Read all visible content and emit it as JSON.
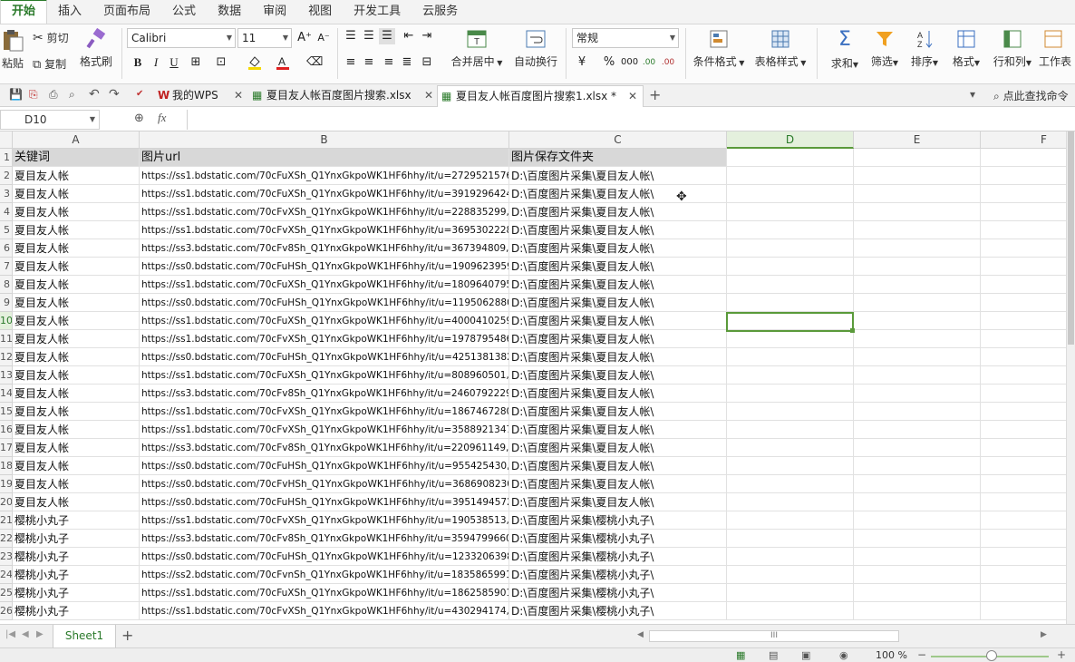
{
  "menu": [
    "开始",
    "插入",
    "页面布局",
    "公式",
    "数据",
    "审阅",
    "视图",
    "开发工具",
    "云服务"
  ],
  "ribbon": {
    "paste": "粘贴",
    "cut": "剪切",
    "copy": "复制",
    "format_painter": "格式刷",
    "font_name": "Calibri",
    "font_size": "11",
    "merge_center": "合并居中",
    "wrap_text": "自动换行",
    "number_format": "常规",
    "conditional_format": "条件格式",
    "table_style": "表格样式",
    "sum": "求和",
    "filter": "筛选",
    "sort": "排序",
    "format": "格式",
    "row_col": "行和列",
    "worksheet": "工作表",
    "percent": "%",
    "thousands": "000",
    "inc_decimal": ".00",
    "dec_decimal": ".00",
    "font_color": "#e02020",
    "fill_color": "#f5d800"
  },
  "tabs": [
    {
      "label": "我的WPS"
    },
    {
      "label": "夏目友人帐百度图片搜索.xlsx"
    },
    {
      "label": "夏目友人帐百度图片搜索1.xlsx *"
    }
  ],
  "find_command": "点此查找命令",
  "name_box": "D10",
  "fx": "fx",
  "columns": [
    "A",
    "B",
    "C",
    "D",
    "E",
    "F"
  ],
  "header_row": {
    "row": "1",
    "a": "关键词",
    "b": "图片url",
    "c": "图片保存文件夹"
  },
  "rows": [
    {
      "row": "2",
      "a": "夏目友人帐",
      "b": "https://ss1.bdstatic.com/70cFuXSh_Q1YnxGkpoWK1HF6hhy/it/u=2729521576",
      "c": "D:\\百度图片采集\\夏目友人帐\\"
    },
    {
      "row": "3",
      "a": "夏目友人帐",
      "b": "https://ss1.bdstatic.com/70cFuXSh_Q1YnxGkpoWK1HF6hhy/it/u=3919296424",
      "c": "D:\\百度图片采集\\夏目友人帐\\"
    },
    {
      "row": "4",
      "a": "夏目友人帐",
      "b": "https://ss1.bdstatic.com/70cFvXSh_Q1YnxGkpoWK1HF6hhy/it/u=228835299,3",
      "c": "D:\\百度图片采集\\夏目友人帐\\"
    },
    {
      "row": "5",
      "a": "夏目友人帐",
      "b": "https://ss1.bdstatic.com/70cFvXSh_Q1YnxGkpoWK1HF6hhy/it/u=3695302228,",
      "c": "D:\\百度图片采集\\夏目友人帐\\"
    },
    {
      "row": "6",
      "a": "夏目友人帐",
      "b": "https://ss3.bdstatic.com/70cFv8Sh_Q1YnxGkpoWK1HF6hhy/it/u=367394809,4",
      "c": "D:\\百度图片采集\\夏目友人帐\\"
    },
    {
      "row": "7",
      "a": "夏目友人帐",
      "b": "https://ss0.bdstatic.com/70cFuHSh_Q1YnxGkpoWK1HF6hhy/it/u=1909623959",
      "c": "D:\\百度图片采集\\夏目友人帐\\"
    },
    {
      "row": "8",
      "a": "夏目友人帐",
      "b": "https://ss1.bdstatic.com/70cFuXSh_Q1YnxGkpoWK1HF6hhy/it/u=1809640795",
      "c": "D:\\百度图片采集\\夏目友人帐\\"
    },
    {
      "row": "9",
      "a": "夏目友人帐",
      "b": "https://ss0.bdstatic.com/70cFuHSh_Q1YnxGkpoWK1HF6hhy/it/u=1195062880",
      "c": "D:\\百度图片采集\\夏目友人帐\\"
    },
    {
      "row": "10",
      "a": "夏目友人帐",
      "b": "https://ss1.bdstatic.com/70cFuXSh_Q1YnxGkpoWK1HF6hhy/it/u=4000410259",
      "c": "D:\\百度图片采集\\夏目友人帐\\"
    },
    {
      "row": "11",
      "a": "夏目友人帐",
      "b": "https://ss1.bdstatic.com/70cFvXSh_Q1YnxGkpoWK1HF6hhy/it/u=1978795486,",
      "c": "D:\\百度图片采集\\夏目友人帐\\"
    },
    {
      "row": "12",
      "a": "夏目友人帐",
      "b": "https://ss0.bdstatic.com/70cFuHSh_Q1YnxGkpoWK1HF6hhy/it/u=4251381382",
      "c": "D:\\百度图片采集\\夏目友人帐\\"
    },
    {
      "row": "13",
      "a": "夏目友人帐",
      "b": "https://ss1.bdstatic.com/70cFuXSh_Q1YnxGkpoWK1HF6hhy/it/u=808960501,3",
      "c": "D:\\百度图片采集\\夏目友人帐\\"
    },
    {
      "row": "14",
      "a": "夏目友人帐",
      "b": "https://ss3.bdstatic.com/70cFv8Sh_Q1YnxGkpoWK1HF6hhy/it/u=2460792229,",
      "c": "D:\\百度图片采集\\夏目友人帐\\"
    },
    {
      "row": "15",
      "a": "夏目友人帐",
      "b": "https://ss1.bdstatic.com/70cFvXSh_Q1YnxGkpoWK1HF6hhy/it/u=1867467280,",
      "c": "D:\\百度图片采集\\夏目友人帐\\"
    },
    {
      "row": "16",
      "a": "夏目友人帐",
      "b": "https://ss1.bdstatic.com/70cFvXSh_Q1YnxGkpoWK1HF6hhy/it/u=3588921347,",
      "c": "D:\\百度图片采集\\夏目友人帐\\"
    },
    {
      "row": "17",
      "a": "夏目友人帐",
      "b": "https://ss3.bdstatic.com/70cFv8Sh_Q1YnxGkpoWK1HF6hhy/it/u=220961149,4",
      "c": "D:\\百度图片采集\\夏目友人帐\\"
    },
    {
      "row": "18",
      "a": "夏目友人帐",
      "b": "https://ss0.bdstatic.com/70cFuHSh_Q1YnxGkpoWK1HF6hhy/it/u=955425430,",
      "c": "D:\\百度图片采集\\夏目友人帐\\"
    },
    {
      "row": "19",
      "a": "夏目友人帐",
      "b": "https://ss0.bdstatic.com/70cFvHSh_Q1YnxGkpoWK1HF6hhy/it/u=3686908230",
      "c": "D:\\百度图片采集\\夏目友人帐\\"
    },
    {
      "row": "20",
      "a": "夏目友人帐",
      "b": "https://ss0.bdstatic.com/70cFuHSh_Q1YnxGkpoWK1HF6hhy/it/u=3951494572",
      "c": "D:\\百度图片采集\\夏目友人帐\\"
    },
    {
      "row": "21",
      "a": "樱桃小丸子",
      "b": "https://ss1.bdstatic.com/70cFvXSh_Q1YnxGkpoWK1HF6hhy/it/u=190538513,1",
      "c": "D:\\百度图片采集\\樱桃小丸子\\"
    },
    {
      "row": "22",
      "a": "樱桃小丸子",
      "b": "https://ss3.bdstatic.com/70cFv8Sh_Q1YnxGkpoWK1HF6hhy/it/u=3594799660,",
      "c": "D:\\百度图片采集\\樱桃小丸子\\"
    },
    {
      "row": "23",
      "a": "樱桃小丸子",
      "b": "https://ss0.bdstatic.com/70cFuHSh_Q1YnxGkpoWK1HF6hhy/it/u=1233206398",
      "c": "D:\\百度图片采集\\樱桃小丸子\\"
    },
    {
      "row": "24",
      "a": "樱桃小丸子",
      "b": "https://ss2.bdstatic.com/70cFvnSh_Q1YnxGkpoWK1HF6hhy/it/u=1835865991,",
      "c": "D:\\百度图片采集\\樱桃小丸子\\"
    },
    {
      "row": "25",
      "a": "樱桃小丸子",
      "b": "https://ss1.bdstatic.com/70cFuXSh_Q1YnxGkpoWK1HF6hhy/it/u=1862585901",
      "c": "D:\\百度图片采集\\樱桃小丸子\\"
    },
    {
      "row": "26",
      "a": "樱桃小丸子",
      "b": "https://ss1.bdstatic.com/70cFvXSh_Q1YnxGkpoWK1HF6hhy/it/u=430294174,1",
      "c": "D:\\百度图片采集\\樱桃小丸子\\"
    }
  ],
  "sheet_tab": "Sheet1",
  "hscroll_grip": "III",
  "zoom": "100 %",
  "colors": {
    "accent": "#2a7a2a",
    "selection": "#5a9a3a"
  }
}
